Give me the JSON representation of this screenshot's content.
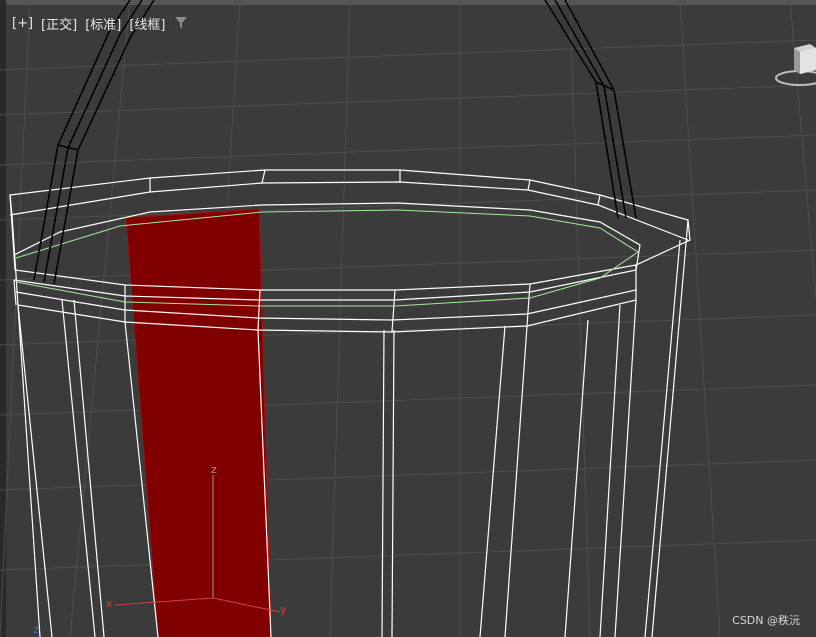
{
  "viewport": {
    "plus_label": "[+]",
    "view_label": "[正交]",
    "shading_label": "[标准]",
    "mode_label": "[线框]",
    "filter_icon": "filter-icon"
  },
  "gizmo": {
    "z_label": "z",
    "x_label": "x",
    "y_label": "y",
    "world_z_label": "z"
  },
  "watermark": "CSDN @秩沅",
  "colors": {
    "background": "#3b3b3b",
    "grid": "#4e4e4e",
    "wire": "#ffffff",
    "selected_face": "#800000",
    "rim_highlight": "#a8e6a0",
    "axis_x": "#d04040",
    "axis_z": "#9a9a9a",
    "world_z": "#4060ff"
  }
}
